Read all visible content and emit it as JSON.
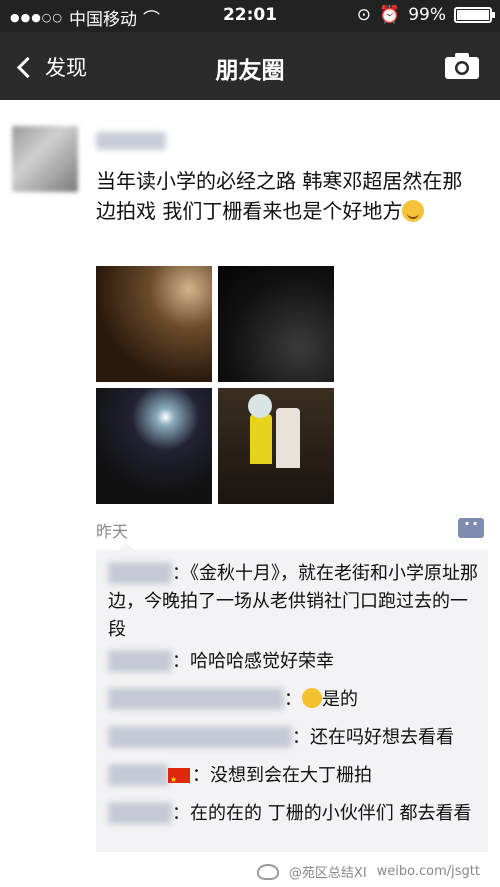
{
  "status": {
    "carrier": "中国移动",
    "time": "22:01",
    "battery": "99%",
    "battery_level": 0.99
  },
  "nav": {
    "back_label": "发现",
    "title": "朋友圈"
  },
  "post": {
    "text": "当年读小学的必经之路 韩寒邓超居然在那边拍戏 我们丁栅看来也是个好地方",
    "time": "昨天"
  },
  "comments": [
    {
      "text": "：《金秋十月》，就在老街和小学原址那边，今晚拍了一场从老供销社门口跑过去的一段"
    },
    {
      "text": "：哈哈哈感觉好荣幸"
    },
    {
      "text": "：",
      "tail": "是的"
    },
    {
      "text": "：还在吗好想去看看"
    },
    {
      "text": "：没想到会在大丁栅拍"
    },
    {
      "text": "：在的在的 丁栅的小伙伴们 都去看看"
    }
  ],
  "watermark": {
    "left": "@苑区总结XI",
    "right": "weibo.com/jsgtt"
  },
  "icons": {
    "back": "chevron-left-icon",
    "camera": "camera-icon",
    "comment": "comment-icon"
  }
}
